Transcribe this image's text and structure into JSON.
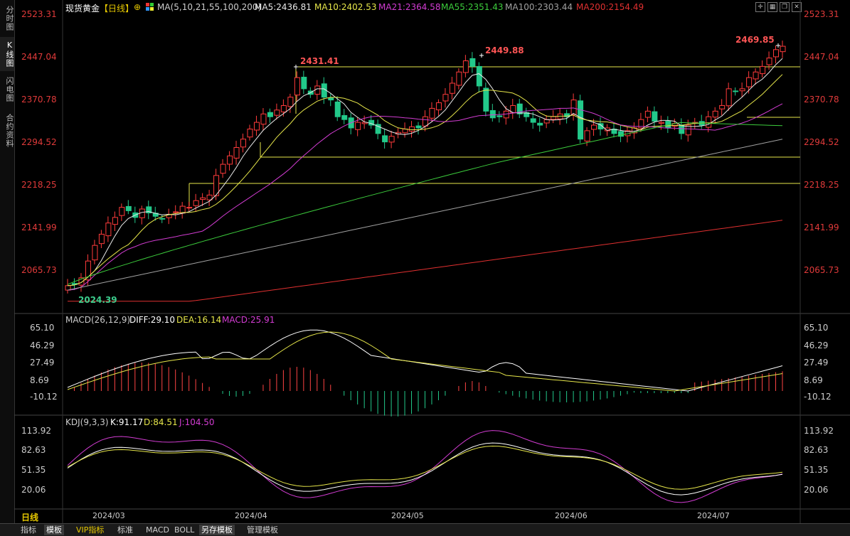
{
  "sidebar": {
    "tabs": [
      {
        "label": "分时图"
      },
      {
        "label": "K线图"
      },
      {
        "label": "闪电图"
      },
      {
        "label": "合约资料"
      }
    ]
  },
  "header": {
    "title": "现货黄金",
    "period": "【日线】",
    "ma_label": "MA(5,10,21,55,100,200)",
    "ma_values": [
      {
        "text": "MA5:2436.81",
        "color": "#e8e8e8"
      },
      {
        "text": "MA10:2402.53",
        "color": "#e6e64a"
      },
      {
        "text": "MA21:2364.58",
        "color": "#d23cd2"
      },
      {
        "text": "MA55:2351.43",
        "color": "#3ccc3c"
      },
      {
        "text": "MA100:2303.44",
        "color": "#a0a0a0"
      },
      {
        "text": "MA200:2154.49",
        "color": "#e03030"
      }
    ]
  },
  "price_axis": {
    "labels": [
      "2523.31",
      "2447.04",
      "2370.78",
      "2294.52",
      "2218.25",
      "2141.99",
      "2065.73"
    ],
    "color": "#e03a3a"
  },
  "annotations": {
    "low": "2024.39",
    "high1": "2431.41",
    "high2": "2449.88",
    "high3": "2469.85"
  },
  "macd": {
    "title": "MACD(26,12,9)",
    "diff": "DIFF:29.10",
    "dea": "DEA:16.14",
    "macd": "MACD:25.91",
    "axis_labels": [
      "65.10",
      "46.29",
      "27.49",
      "8.69",
      "-10.12"
    ]
  },
  "kdj": {
    "title": "KDJ(9,3,3)",
    "k": "K:91.17",
    "d": "D:84.51",
    "j": "J:104.50",
    "axis_labels": [
      "113.92",
      "82.63",
      "51.35",
      "20.06"
    ]
  },
  "date_axis": {
    "period_label": "日线",
    "dates": [
      "2024/03",
      "2024/04",
      "2024/05",
      "2024/06",
      "2024/07"
    ]
  },
  "bottom_bar": {
    "buttons": [
      {
        "label": "指标"
      },
      {
        "label": "模板"
      },
      {
        "label": "VIP指标"
      },
      {
        "label": "标准"
      },
      {
        "label": "MACD"
      },
      {
        "label": "BOLL"
      },
      {
        "label": "另存模板"
      },
      {
        "label": "管理模板"
      }
    ]
  },
  "chart_data": {
    "type": "candlestick",
    "title": "现货黄金",
    "ylim": [
      2024.39,
      2523.31
    ],
    "series": [
      {
        "name": "MA5",
        "last": 2436.81
      },
      {
        "name": "MA10",
        "last": 2402.53
      },
      {
        "name": "MA21",
        "last": 2364.58
      },
      {
        "name": "MA55",
        "last": 2351.43
      },
      {
        "name": "MA100",
        "last": 2303.44
      },
      {
        "name": "MA200",
        "last": 2154.49
      }
    ],
    "closes": [
      2038,
      2040,
      2052,
      2082,
      2110,
      2130,
      2150,
      2160,
      2178,
      2172,
      2160,
      2175,
      2168,
      2162,
      2158,
      2165,
      2170,
      2180,
      2178,
      2190,
      2195,
      2200,
      2235,
      2255,
      2270,
      2285,
      2300,
      2318,
      2330,
      2345,
      2340,
      2352,
      2360,
      2375,
      2410,
      2390,
      2380,
      2395,
      2375,
      2370,
      2340,
      2335,
      2320,
      2330,
      2330,
      2325,
      2310,
      2295,
      2305,
      2312,
      2318,
      2322,
      2320,
      2340,
      2355,
      2365,
      2380,
      2400,
      2420,
      2440,
      2430,
      2395,
      2350,
      2338,
      2340,
      2350,
      2360,
      2345,
      2340,
      2330,
      2325,
      2335,
      2340,
      2345,
      2340,
      2370,
      2300,
      2315,
      2325,
      2318,
      2320,
      2310,
      2305,
      2315,
      2320,
      2335,
      2350,
      2332,
      2330,
      2320,
      2328,
      2310,
      2325,
      2330,
      2325,
      2340,
      2350,
      2360,
      2390,
      2385,
      2390,
      2410,
      2420,
      2430,
      2445,
      2460,
      2466
    ]
  }
}
